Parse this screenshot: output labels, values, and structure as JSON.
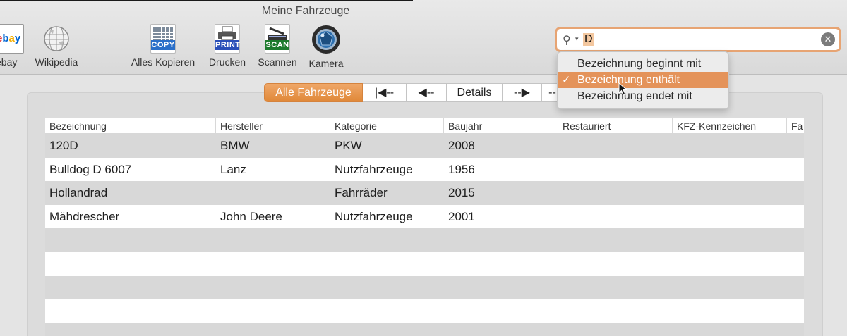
{
  "window": {
    "title": "Meine Fahrzeuge"
  },
  "toolbar": {
    "ebay": {
      "label": "ebay",
      "logo": "ebay"
    },
    "wikipedia": {
      "label": "Wikipedia"
    },
    "copy": {
      "label": "Alles Kopieren",
      "tag": "COPY"
    },
    "print": {
      "label": "Drucken",
      "tag": "PRINT"
    },
    "scan": {
      "label": "Scannen",
      "tag": "SCAN"
    },
    "camera": {
      "label": "Kamera"
    }
  },
  "search": {
    "value": "D",
    "menu": [
      {
        "label": "Bezeichnung beginnt mit",
        "selected": false
      },
      {
        "label": "Bezeichnung enthält",
        "selected": true
      },
      {
        "label": "Bezeichnung endet mit",
        "selected": false
      }
    ],
    "check": "✓"
  },
  "nav": {
    "all": "Alle Fahrzeuge",
    "first": "|◀--",
    "prev": "◀--",
    "details": "Details",
    "next": "--▶",
    "last": "--"
  },
  "table": {
    "columns": [
      "Bezeichnung",
      "Hersteller",
      "Kategorie",
      "Baujahr",
      "Restauriert",
      "KFZ-Kennzeichen",
      "Fa"
    ],
    "rows": [
      [
        "120D",
        "BMW",
        "PKW",
        "2008",
        "",
        "",
        ""
      ],
      [
        "Bulldog D 6007",
        "Lanz",
        "Nutzfahrzeuge",
        "1956",
        "",
        "",
        ""
      ],
      [
        "Hollandrad",
        "",
        "Fahrräder",
        "2015",
        "",
        "",
        ""
      ],
      [
        "Mähdrescher",
        "John Deere",
        "Nutzfahrzeuge",
        "2001",
        "",
        "",
        ""
      ],
      [
        "",
        "",
        "",
        "",
        "",
        "",
        ""
      ],
      [
        "",
        "",
        "",
        "",
        "",
        "",
        ""
      ],
      [
        "",
        "",
        "",
        "",
        "",
        "",
        ""
      ],
      [
        "",
        "",
        "",
        "",
        "",
        "",
        ""
      ],
      [
        "",
        "",
        "",
        "",
        "",
        "",
        ""
      ]
    ]
  },
  "colors": {
    "accent": "#e4935a",
    "search_border": "#e7a473"
  }
}
